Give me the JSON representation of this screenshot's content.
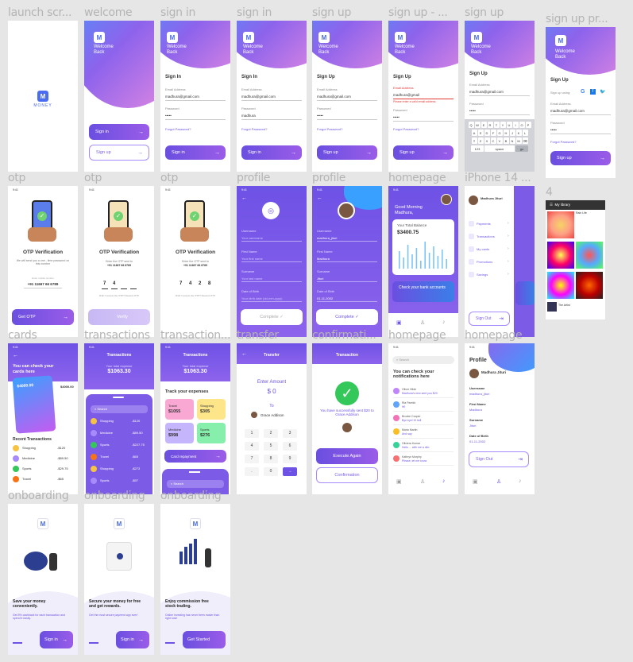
{
  "labels": {
    "launch": "launch scr...",
    "welcome": "welcome",
    "signin1": "sign in",
    "signin2": "sign in",
    "signup1": "sign up",
    "signup2": "sign up - ...",
    "signup3": "sign up",
    "signuppr": "sign up pr...",
    "otp1": "otp",
    "otp2": "otp",
    "otp3": "otp",
    "profile1": "profile",
    "profile2": "profile",
    "homepage1": "homepage",
    "iphone": "iPhone 14 ...",
    "four": "4",
    "cards": "cards",
    "transactions1": "transactions",
    "transactions2": "transaction...",
    "transfer": "transfer",
    "confirmation": "confirmati...",
    "homepage2": "homepage",
    "homepage3": "homepage",
    "onboarding1": "onboarding",
    "onboarding2": "onboarding",
    "onboarding3": "onboarding"
  },
  "brand": "MONEY",
  "colors": {
    "primary": "#6e52e6",
    "accent": "#9a5ce8",
    "success": "#34c759",
    "error": "#e53935"
  },
  "welcome": {
    "line1": "Welcome",
    "line2": "Back",
    "signin": "Sign in",
    "signup": "Sign up"
  },
  "signin": {
    "title": "Sign In",
    "email_label": "Email Address",
    "email": "madhura@gmail.com",
    "password_label": "Password",
    "password": "•••••",
    "forgot": "Forgot Password?",
    "button": "Sign in",
    "email2": "madhura@gmail.com",
    "password2": "madhura"
  },
  "signup": {
    "title": "Sign Up",
    "email_label": "Email Address",
    "email": "madhura@gmail.com",
    "password_label": "Password",
    "password": "•••••",
    "forgot": "Forgot Password?",
    "button": "Sign up",
    "error_label": "Email Address",
    "error_email": "madhura@gmail",
    "error_msg": "Please enter a valid email address",
    "signup_using": "Sign up using:"
  },
  "keyboard": {
    "row1": [
      "Q",
      "W",
      "E",
      "R",
      "T",
      "Y",
      "U",
      "I",
      "O",
      "P"
    ],
    "row2": [
      "A",
      "S",
      "D",
      "F",
      "G",
      "H",
      "J",
      "K",
      "L"
    ],
    "row3": [
      "⇧",
      "Z",
      "X",
      "C",
      "V",
      "B",
      "N",
      "M",
      "⌫"
    ],
    "k123": "123",
    "space": "space",
    "go": "go"
  },
  "otp": {
    "title": "OTP Verification",
    "desc1": "We will send you a one - time password on this number",
    "phone_label": "Enter mobile number",
    "phone": "+91 11667 66 6789",
    "get": "Get OTP",
    "desc2": "Enter the OTP sent to",
    "digits1": [
      "7",
      "4",
      "",
      ""
    ],
    "digits2": [
      "7",
      "4",
      "2",
      "8"
    ],
    "resend": "Didn't receive the OTP? Resend OTP",
    "verify": "Verify"
  },
  "profile": {
    "username_label": "Username",
    "username_ph": "Your username",
    "username": "madhura_jituri",
    "first_label": "First Name",
    "first_ph": "Your first name",
    "first": "Madhura",
    "surname_label": "Surname",
    "surname_ph": "Your last name",
    "surname": "Jituri",
    "dob_label": "Date of Birth",
    "dob_ph": "Your birth date (dd-mm-yyyy)",
    "dob": "01-11-2002",
    "complete": "Complete",
    "title": "Profile",
    "username2": "madhura_jituri",
    "sign_out": "Sign Out",
    "name": "Madhura Jituri"
  },
  "home": {
    "greet": "Good Morning Madhura,",
    "balance_label": "Your Total Balance",
    "balance": "$3400.75",
    "check": "Check your bank accounts"
  },
  "menu": {
    "name": "Madhura Jituri",
    "items": [
      "Payments",
      "Transactions",
      "My cards",
      "Promotions",
      "Savings"
    ],
    "sign_out": "Sign Out"
  },
  "library": {
    "title": "My library",
    "item1": "Rain Life",
    "item2": "Digital art",
    "item3": "The Artist"
  },
  "cards": {
    "title": "You can check your cards here",
    "amount": "$4000.00",
    "amount2": "$4000.00",
    "recent": "Recent Transactions",
    "tx": [
      {
        "n": "Shopping",
        "v": "-$120"
      },
      {
        "n": "Medicine",
        "v": "-$89.50"
      },
      {
        "n": "Sports",
        "v": "-$29.75"
      },
      {
        "n": "Travel",
        "v": "-$65"
      }
    ]
  },
  "transactions": {
    "title": "Transactions",
    "expense_label": "Your total expense",
    "expense": "$1063.30",
    "search": "Search",
    "list": [
      {
        "n": "Shopping",
        "v": "-$120"
      },
      {
        "n": "Medicine",
        "v": "-$89.50"
      },
      {
        "n": "Sports",
        "v": "-$227.75"
      },
      {
        "n": "Travel",
        "v": "-$65"
      },
      {
        "n": "Shopping",
        "v": "-$273"
      },
      {
        "n": "Sports",
        "v": "-$97"
      }
    ],
    "track": "Track your expenses",
    "tiles": [
      {
        "n": "Travel",
        "v": "$1055"
      },
      {
        "n": "Shopping",
        "v": "$305"
      },
      {
        "n": "Medicine",
        "v": "$998"
      },
      {
        "n": "Sports",
        "v": "$276"
      }
    ],
    "repayment": "Card repayment"
  },
  "transfer": {
    "title": "Transfer",
    "enter": "Enter Amount",
    "amount": "$ 0",
    "to": "To",
    "recipient": "Grace Addison",
    "keys": [
      "1",
      "2",
      "3",
      "4",
      "5",
      "6",
      "7",
      "8",
      "9",
      ".",
      "0",
      "→"
    ]
  },
  "confirm": {
    "title": "Transaction",
    "msg": "You have successfully sent $20 to Grace Addison",
    "execute": "Execute Again",
    "confirmation": "Confirmation"
  },
  "notif": {
    "search": "Search",
    "title": "You can check your notifications here",
    "items": [
      {
        "n": "Oliver Hilde",
        "m": "Madhura's new sent you $20"
      },
      {
        "n": "Ria Parekh",
        "m": "Hi!"
      },
      {
        "n": "Brooke Cooper",
        "m": "Bye bye! Hi hell"
      },
      {
        "n": "Maria Martin",
        "m": "And say"
      },
      {
        "n": "Oliviera Kumar",
        "m": "Hello ... with me a dim"
      },
      {
        "n": "Kathryn Murphy",
        "m": "Please, let me know"
      }
    ]
  },
  "onboarding": [
    {
      "title": "Save your money conveniently.",
      "desc": "Get 5% cashback for each transaction and spend it easily.",
      "button": "Sign in"
    },
    {
      "title": "Secure your money for free and get rewards.",
      "desc": "Get the most secure payment app ever!",
      "button": "Sign in"
    },
    {
      "title": "Enjoy commission free stock trading.",
      "desc": "Online investing has never been easier than right now!",
      "button": "Get Started"
    }
  ],
  "time": "9:41"
}
